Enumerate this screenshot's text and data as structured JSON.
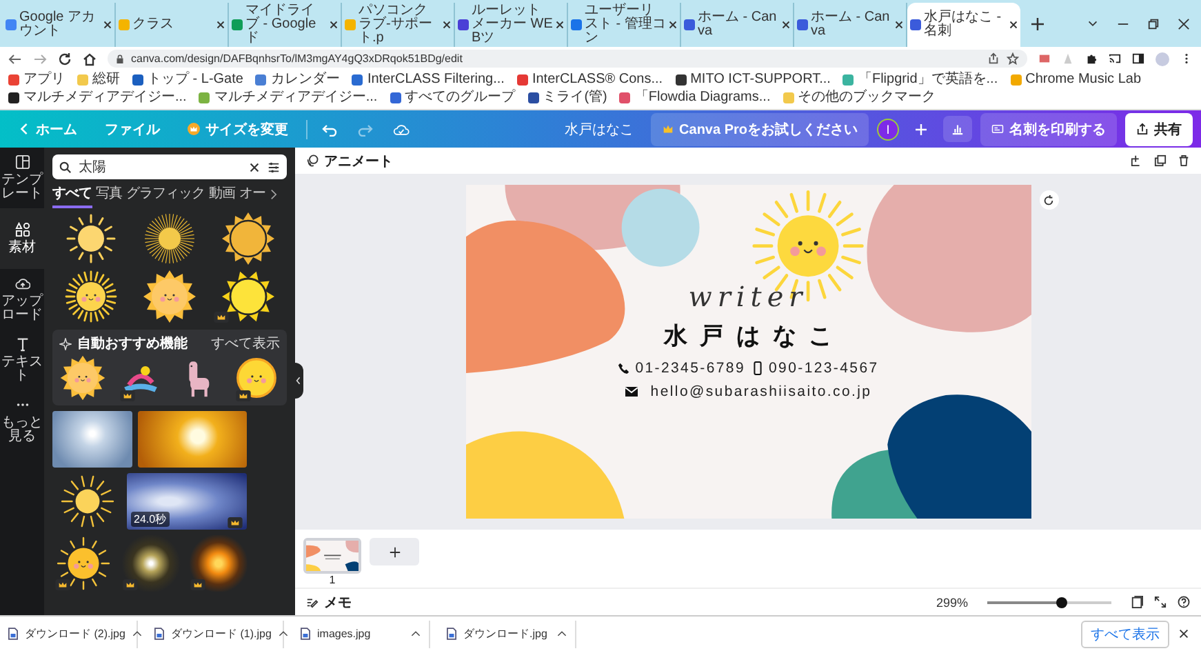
{
  "browser": {
    "tabs": [
      {
        "title": "Google アカウント",
        "selected": false,
        "color": "#4285f4"
      },
      {
        "title": "クラス",
        "selected": false,
        "color": "#f4b400"
      },
      {
        "title": "マイドライブ - Google ド",
        "selected": false,
        "color": "#0f9d58"
      },
      {
        "title": "パソコンクラブ-サポート.p",
        "selected": false,
        "color": "#f4b400"
      },
      {
        "title": "ルーレットメーカー WEBツ",
        "selected": false,
        "color": "#4b3fd6"
      },
      {
        "title": "ユーザーリスト - 管理コン",
        "selected": false,
        "color": "#1a73e8"
      },
      {
        "title": "ホーム - Canva",
        "selected": false,
        "color": "#3b5bdb"
      },
      {
        "title": "ホーム - Canva",
        "selected": false,
        "color": "#3b5bdb"
      },
      {
        "title": "水戸はなこ - 名刺",
        "selected": true,
        "color": "#3b5bdb"
      }
    ],
    "url": "canva.com/design/DAFBqnhsrTo/lM3mgAY4gQ3xDRqok51BDg/edit",
    "bookmarks": [
      {
        "label": "アプリ",
        "color": "#ea4335"
      },
      {
        "label": "総研",
        "color": "#f2c94c"
      },
      {
        "label": "トップ - L-Gate",
        "color": "#1b5fbf"
      },
      {
        "label": "カレンダー",
        "color": "#4a7fd4"
      },
      {
        "label": "InterCLASS Filtering...",
        "color": "#2a6bd1"
      },
      {
        "label": "InterCLASS® Cons...",
        "color": "#e53935"
      },
      {
        "label": "MITO ICT-SUPPORT...",
        "color": "#333333"
      },
      {
        "label": "「Flipgrid」で英語を...",
        "color": "#3bb4a0"
      },
      {
        "label": "Chrome Music Lab",
        "color": "#f2a900"
      },
      {
        "label": "マルチメディアデイジー...",
        "color": "#222222"
      },
      {
        "label": "マルチメディアデイジー...",
        "color": "#7cb342"
      },
      {
        "label": "すべてのグループ",
        "color": "#3367d6"
      },
      {
        "label": "ミライ(管)",
        "color": "#2b4ea2"
      },
      {
        "label": "「Flowdia Diagrams...",
        "color": "#e0506a"
      },
      {
        "label": "その他のブックマーク",
        "color": "#f2c94c"
      }
    ]
  },
  "toolbar": {
    "home": "ホーム",
    "file": "ファイル",
    "resize": "サイズを変更",
    "design_title": "水戸はなこ",
    "pro_button": "Canva Proをお試しください",
    "avatar": "I",
    "print_button": "名刺を印刷する",
    "share_button": "共有"
  },
  "rail": [
    {
      "label": "テンプレート",
      "kind": "template",
      "selected": false
    },
    {
      "label": "素材",
      "kind": "elements",
      "selected": true
    },
    {
      "label": "アップロード",
      "kind": "upload",
      "selected": false
    },
    {
      "label": "テキスト",
      "kind": "text",
      "selected": false
    },
    {
      "label": "もっと見る",
      "kind": "more",
      "selected": false
    }
  ],
  "panel": {
    "search": {
      "value": "太陽"
    },
    "filters": [
      {
        "label": "すべて",
        "selected": true
      },
      {
        "label": "写真",
        "selected": false
      },
      {
        "label": "グラフィック",
        "selected": false
      },
      {
        "label": "動画",
        "selected": false
      },
      {
        "label": "オー",
        "selected": false
      }
    ],
    "graphics": [
      {
        "kind": "sun-rays",
        "premium": false
      },
      {
        "kind": "sun-burst",
        "premium": false
      },
      {
        "kind": "sun-spiky",
        "premium": false
      },
      {
        "kind": "sun-face",
        "premium": false
      },
      {
        "kind": "sun-star",
        "premium": false
      },
      {
        "kind": "sun-triangles",
        "premium": true
      }
    ],
    "recommended": {
      "title": "自動おすすめ機能",
      "link": "すべて表示",
      "items": [
        {
          "kind": "sun-star",
          "premium": false
        },
        {
          "kind": "sticker",
          "premium": true
        },
        {
          "kind": "alpaca",
          "premium": false
        },
        {
          "kind": "sun-blob",
          "premium": true
        }
      ]
    },
    "more": [
      {
        "kind": "photo-sky",
        "premium": false
      },
      {
        "kind": "photo-sunset",
        "premium": false
      },
      {
        "kind": "sun-sketch",
        "premium": false
      },
      {
        "kind": "video-clouds",
        "premium": true,
        "duration": "24.0秒"
      },
      {
        "kind": "sun-smile",
        "premium": true
      },
      {
        "kind": "glow-white",
        "premium": true
      },
      {
        "kind": "glow-orange",
        "premium": true
      }
    ]
  },
  "editor": {
    "animate": "アニメート",
    "card": {
      "title": "writer",
      "name": "水戸はなこ",
      "phone": "01-2345-6789",
      "mobile": "090-123-4567",
      "email": "hello@subarashiisaito.co.jp"
    },
    "pages": [
      {
        "number": "1",
        "selected": true
      }
    ],
    "notes": "メモ",
    "zoom": {
      "reading": "299%",
      "level": 0.6
    }
  },
  "downloads": {
    "files": [
      "ダウンロード (2).jpg",
      "ダウンロード (1).jpg",
      "images.jpg",
      "ダウンロード.jpg"
    ],
    "show_all": "すべて表示"
  }
}
